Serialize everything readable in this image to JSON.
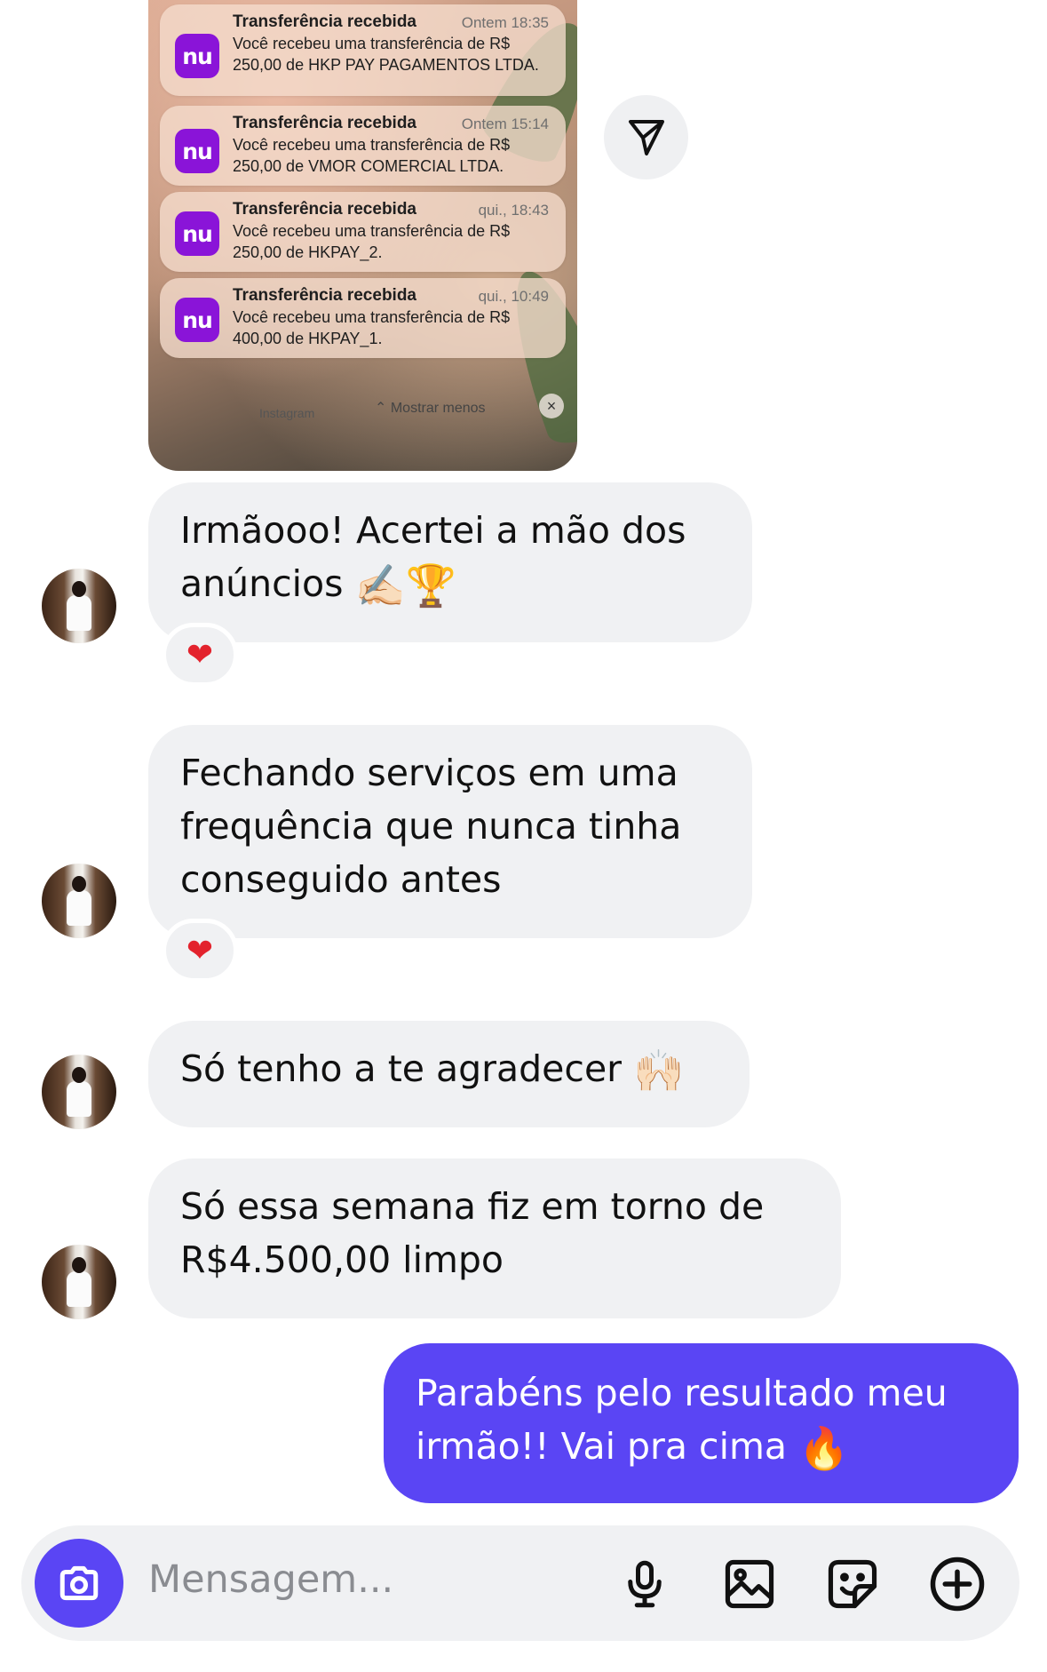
{
  "notifications": [
    {
      "app_icon": "nu",
      "title": "Transferência recebida",
      "time": "Ontem 18:35",
      "body": "Você recebeu uma transferência de R$ 250,00 de HKP PAY PAGAMENTOS LTDA."
    },
    {
      "app_icon": "nu",
      "title": "Transferência recebida",
      "time": "Ontem 15:14",
      "body": "Você recebeu uma transferência de R$ 250,00 de VMOR COMERCIAL LTDA."
    },
    {
      "app_icon": "nu",
      "title": "Transferência recebida",
      "time": "qui., 18:43",
      "body": "Você recebeu uma transferência de R$ 250,00 de HKPAY_2."
    },
    {
      "app_icon": "nu",
      "title": "Transferência recebida",
      "time": "qui., 10:49",
      "body": "Você recebeu uma transferência de R$ 400,00 de HKPAY_1."
    }
  ],
  "notif_footer": {
    "source": "Instagram",
    "show_less": "⌃ Mostrar menos",
    "close": "×"
  },
  "messages": [
    {
      "text": "Irmãooo! Acertei a mão dos anúncios",
      "emoji": "✍🏻🏆",
      "reaction": "❤"
    },
    {
      "text": "Fechando serviços em uma frequência que nunca tinha conseguido antes",
      "reaction": "❤"
    },
    {
      "text": "Só tenho a te agradecer",
      "emoji": "🙌🏻"
    },
    {
      "text": "Só essa semana fiz em torno de R$4.500,00 limpo"
    }
  ],
  "sent_message": {
    "text": "Parabéns pelo resultado meu irmão!! Vai pra cima",
    "emoji": "🔥"
  },
  "composer": {
    "placeholder": "Mensagem..."
  },
  "icons": [
    "send-icon",
    "camera-icon",
    "microphone-icon",
    "gallery-icon",
    "sticker-icon",
    "plus-icon"
  ],
  "colors": {
    "accent": "#5a45f4",
    "bubble": "#f0f1f3",
    "nubank": "#8a14d8",
    "heart": "#e3232d"
  }
}
